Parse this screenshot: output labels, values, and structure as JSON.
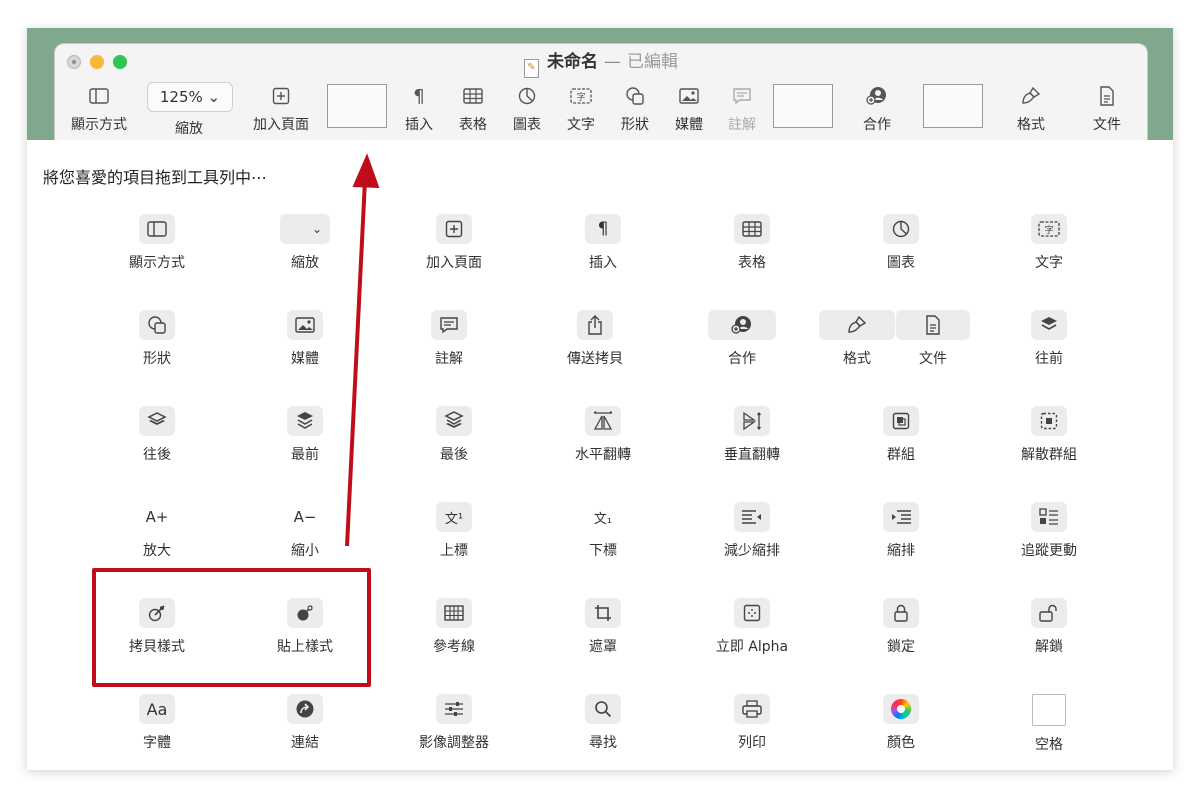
{
  "window": {
    "title": "未命名",
    "separator": "—",
    "status": "已編輯"
  },
  "toolbar": {
    "view_label": "顯示方式",
    "zoom_value": "125%",
    "zoom_label": "縮放",
    "add_page_label": "加入頁面",
    "insert_label": "插入",
    "table_label": "表格",
    "chart_label": "圖表",
    "text_label": "文字",
    "shape_label": "形狀",
    "media_label": "媒體",
    "comment_label": "註解",
    "collaborate_label": "合作",
    "format_label": "格式",
    "document_label": "文件"
  },
  "palette": {
    "heading": "將您喜愛的項目拖到工具列中⋯",
    "rows": [
      [
        "顯示方式",
        "縮放",
        "加入頁面",
        "插入",
        "表格",
        "圖表",
        "文字"
      ],
      [
        "形狀",
        "媒體",
        "註解",
        "傳送拷貝",
        "合作",
        "格式",
        "文件",
        "往前"
      ],
      [
        "往後",
        "最前",
        "最後",
        "水平翻轉",
        "垂直翻轉",
        "群組",
        "解散群組"
      ],
      [
        "放大",
        "縮小",
        "上標",
        "下標",
        "減少縮排",
        "縮排",
        "追蹤更動"
      ],
      [
        "拷貝樣式",
        "貼上樣式",
        "參考線",
        "遮罩",
        "立即 Alpha",
        "鎖定",
        "解鎖"
      ],
      [
        "字體",
        "連結",
        "影像調整器",
        "尋找",
        "列印",
        "顏色",
        "空格"
      ]
    ],
    "glyphs": {
      "a_plus": "A+",
      "a_minus": "A−",
      "superscript": "文¹",
      "subscript": "文₁",
      "font": "Aa"
    }
  },
  "colors": {
    "highlight": "#c00d1a",
    "window_bg": "#7fa88d",
    "close": "#d7d7d7",
    "minimize": "#f6b73a",
    "maximize": "#31c553"
  }
}
